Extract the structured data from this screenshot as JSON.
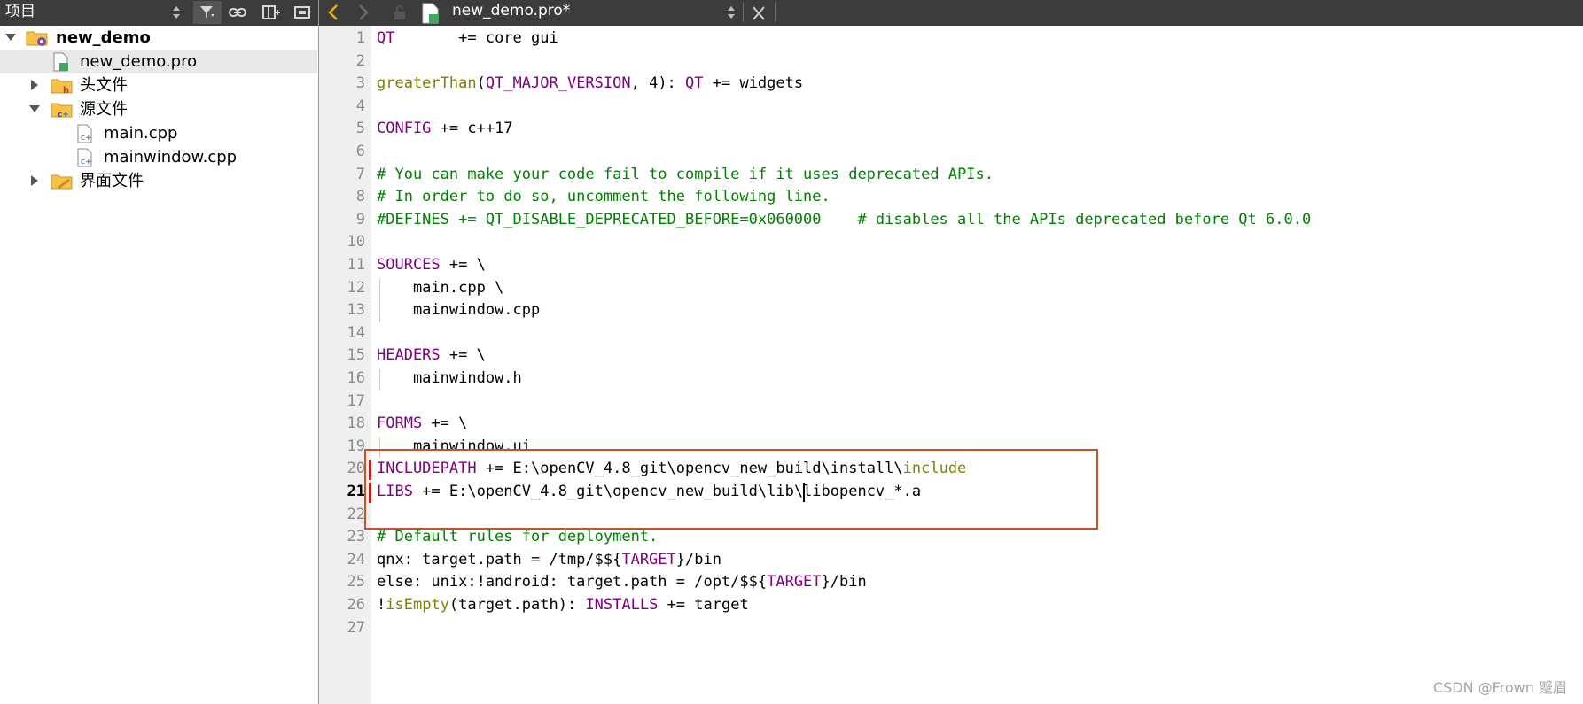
{
  "left_panel": {
    "title": "项目",
    "tree": [
      {
        "label": "new_demo",
        "bold": true,
        "expanded": true,
        "icon": "project-folder-icon",
        "depth": 0,
        "has_arrow": true
      },
      {
        "label": "new_demo.pro",
        "bold": false,
        "icon": "pro-file-icon",
        "depth": 1,
        "has_arrow": false,
        "selected": true
      },
      {
        "label": "头文件",
        "bold": false,
        "expanded": false,
        "icon": "header-folder-icon",
        "depth": 1,
        "has_arrow": true
      },
      {
        "label": "源文件",
        "bold": false,
        "expanded": true,
        "icon": "source-folder-icon",
        "depth": 1,
        "has_arrow": true
      },
      {
        "label": "main.cpp",
        "bold": false,
        "icon": "cpp-file-icon",
        "depth": 2,
        "has_arrow": false
      },
      {
        "label": "mainwindow.cpp",
        "bold": false,
        "icon": "cpp-file-icon",
        "depth": 2,
        "has_arrow": false
      },
      {
        "label": "界面文件",
        "bold": false,
        "expanded": false,
        "icon": "form-folder-icon",
        "depth": 1,
        "has_arrow": true
      }
    ]
  },
  "tab_bar": {
    "document_title": "new_demo.pro*"
  },
  "editor": {
    "current_line": 21,
    "lines": [
      [
        [
          "kw",
          "QT"
        ],
        [
          "t",
          "       += core gui"
        ]
      ],
      [],
      [
        [
          "fn",
          "greaterThan"
        ],
        [
          "t",
          "("
        ],
        [
          "kw",
          "QT_MAJOR_VERSION"
        ],
        [
          "t",
          ", 4): "
        ],
        [
          "kw",
          "QT"
        ],
        [
          "t",
          " += widgets"
        ]
      ],
      [],
      [
        [
          "kw",
          "CONFIG"
        ],
        [
          "t",
          " += c++17"
        ]
      ],
      [],
      [
        [
          "cm",
          "# You can make your code fail to compile if it uses deprecated APIs."
        ]
      ],
      [
        [
          "cm",
          "# In order to do so, uncomment the following line."
        ]
      ],
      [
        [
          "cm",
          "#DEFINES += QT_DISABLE_DEPRECATED_BEFORE=0x060000    # disables all the APIs deprecated before Qt 6.0.0"
        ]
      ],
      [],
      [
        [
          "kw",
          "SOURCES"
        ],
        [
          "t",
          " += \\"
        ]
      ],
      [
        [
          "t",
          "    main.cpp \\"
        ]
      ],
      [
        [
          "t",
          "    mainwindow.cpp"
        ]
      ],
      [],
      [
        [
          "kw",
          "HEADERS"
        ],
        [
          "t",
          " += \\"
        ]
      ],
      [
        [
          "t",
          "    mainwindow.h"
        ]
      ],
      [],
      [
        [
          "kw",
          "FORMS"
        ],
        [
          "t",
          " += \\"
        ]
      ],
      [
        [
          "t",
          "    mainwindow.ui"
        ]
      ],
      [
        [
          "kw",
          "INCLUDEPATH"
        ],
        [
          "t",
          " += E:\\openCV_4.8_git\\opencv_new_build\\install\\"
        ],
        [
          "fn",
          "include"
        ]
      ],
      [
        [
          "kw",
          "LIBS"
        ],
        [
          "t",
          " += E:\\openCV_4.8_git\\opencv_new_build\\lib\\libopencv_*.a"
        ]
      ],
      [],
      [
        [
          "cm",
          "# Default rules for deployment."
        ]
      ],
      [
        [
          "t",
          "qnx: target.path = /tmp/$${"
        ],
        [
          "kw",
          "TARGET"
        ],
        [
          "t",
          "}/bin"
        ]
      ],
      [
        [
          "t",
          "else: unix:!android: target.path = /opt/$${"
        ],
        [
          "kw",
          "TARGET"
        ],
        [
          "t",
          "}/bin"
        ]
      ],
      [
        [
          "t",
          "!"
        ],
        [
          "fn",
          "isEmpty"
        ],
        [
          "t",
          "(target.path): "
        ],
        [
          "kw",
          "INSTALLS"
        ],
        [
          "t",
          " += target"
        ]
      ],
      []
    ]
  },
  "watermark": "CSDN @Frown 蹙眉",
  "colors": {
    "toolbar_bg": "#3c3c3c",
    "keyword": "#800080",
    "function": "#808000",
    "comment": "#008000",
    "highlight_box": "#c0552a",
    "modified_marker": "#d11a1a"
  }
}
